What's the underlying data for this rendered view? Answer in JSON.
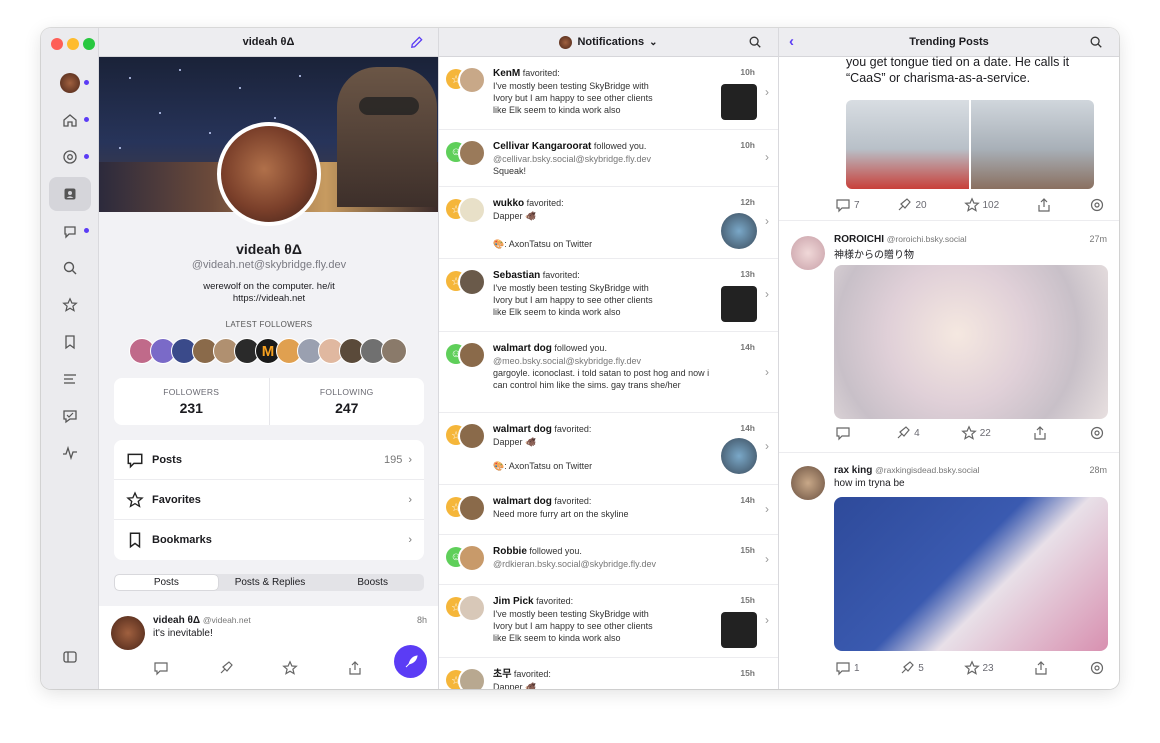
{
  "profile_column": {
    "title": "videah θΔ",
    "display_name": "videah θΔ",
    "handle": "@videah.net@skybridge.fly.dev",
    "bio_line1": "werewolf on the computer. he/it",
    "bio_line2": "https://videah.net",
    "latest_followers_label": "LATEST FOLLOWERS",
    "followers_label": "FOLLOWERS",
    "followers_count": "231",
    "following_label": "FOLLOWING",
    "following_count": "247",
    "menu": [
      {
        "label": "Posts",
        "count": "195"
      },
      {
        "label": "Favorites",
        "count": ""
      },
      {
        "label": "Bookmarks",
        "count": ""
      }
    ],
    "tabs": [
      "Posts",
      "Posts & Replies",
      "Boosts"
    ],
    "post": {
      "name": "videah θΔ",
      "handle": "@videah.net",
      "time": "8h",
      "text": "it's inevitable!"
    }
  },
  "notifications_column": {
    "title": "Notifications",
    "items": [
      {
        "name": "KenM",
        "action": " favorited:",
        "time": "10h",
        "body": "I've mostly been testing SkyBridge with Ivory but I am happy to see other clients like Elk seem to kinda work also",
        "sub": "",
        "extra": "",
        "kind": "fav"
      },
      {
        "name": "Cellivar Kangaroorat",
        "action": " followed you.",
        "time": "10h",
        "body": "Squeak!",
        "sub": "@cellivar.bsky.social@skybridge.fly.dev",
        "extra": "",
        "kind": "follow"
      },
      {
        "name": "wukko",
        "action": " favorited:",
        "time": "12h",
        "body": "Dapper 🐗",
        "sub": "",
        "extra": "🎨: AxonTatsu on Twitter",
        "kind": "fav"
      },
      {
        "name": "Sebastian",
        "action": " favorited:",
        "time": "13h",
        "body": "I've mostly been testing SkyBridge with Ivory but I am happy to see other clients like Elk seem to kinda work also",
        "sub": "",
        "extra": "",
        "kind": "fav"
      },
      {
        "name": "walmart dog",
        "action": " followed you.",
        "time": "14h",
        "body": "gargoyle. iconoclast. i told satan to post hog and now i can control him like the sims. gay trans she/her",
        "sub": "@meo.bsky.social@skybridge.fly.dev",
        "extra": "",
        "kind": "follow"
      },
      {
        "name": "walmart dog",
        "action": " favorited:",
        "time": "14h",
        "body": "Dapper 🐗",
        "sub": "",
        "extra": "🎨: AxonTatsu on Twitter",
        "kind": "fav"
      },
      {
        "name": "walmart dog",
        "action": " favorited:",
        "time": "14h",
        "body": "Need more furry art on the skyline",
        "sub": "",
        "extra": "",
        "kind": "fav"
      },
      {
        "name": "Robbie",
        "action": " followed you.",
        "time": "15h",
        "body": "",
        "sub": "@rdkieran.bsky.social@skybridge.fly.dev",
        "extra": "",
        "kind": "follow"
      },
      {
        "name": "Jim Pick",
        "action": " favorited:",
        "time": "15h",
        "body": "I've mostly been testing SkyBridge with Ivory but I am happy to see other clients like Elk seem to kinda work also",
        "sub": "",
        "extra": "",
        "kind": "fav"
      },
      {
        "name": "초무",
        "action": " favorited:",
        "time": "15h",
        "body": "Dapper 🐗",
        "sub": "",
        "extra": "",
        "kind": "fav"
      }
    ]
  },
  "trending_column": {
    "title": "Trending Posts",
    "post1": {
      "text_line1": "you get tongue tied on a date. He calls it",
      "text_line2": "“CaaS” or charisma-as-a-service.",
      "replies": "7",
      "boosts": "20",
      "favs": "102"
    },
    "post2": {
      "name": "ROROICHI",
      "handle": "@roroichi.bsky.social",
      "time": "27m",
      "text": "神様からの贈り物",
      "replies": "",
      "boosts": "4",
      "favs": "22"
    },
    "post3": {
      "name": "rax king",
      "handle": "@raxkingisdead.bsky.social",
      "time": "28m",
      "text": "how im tryna be",
      "replies": "1",
      "boosts": "5",
      "favs": "23"
    }
  },
  "colors": {
    "accent": "#5b3cf5",
    "fav_badge": "#f5b63a",
    "follow_badge": "#5fcf5a"
  }
}
